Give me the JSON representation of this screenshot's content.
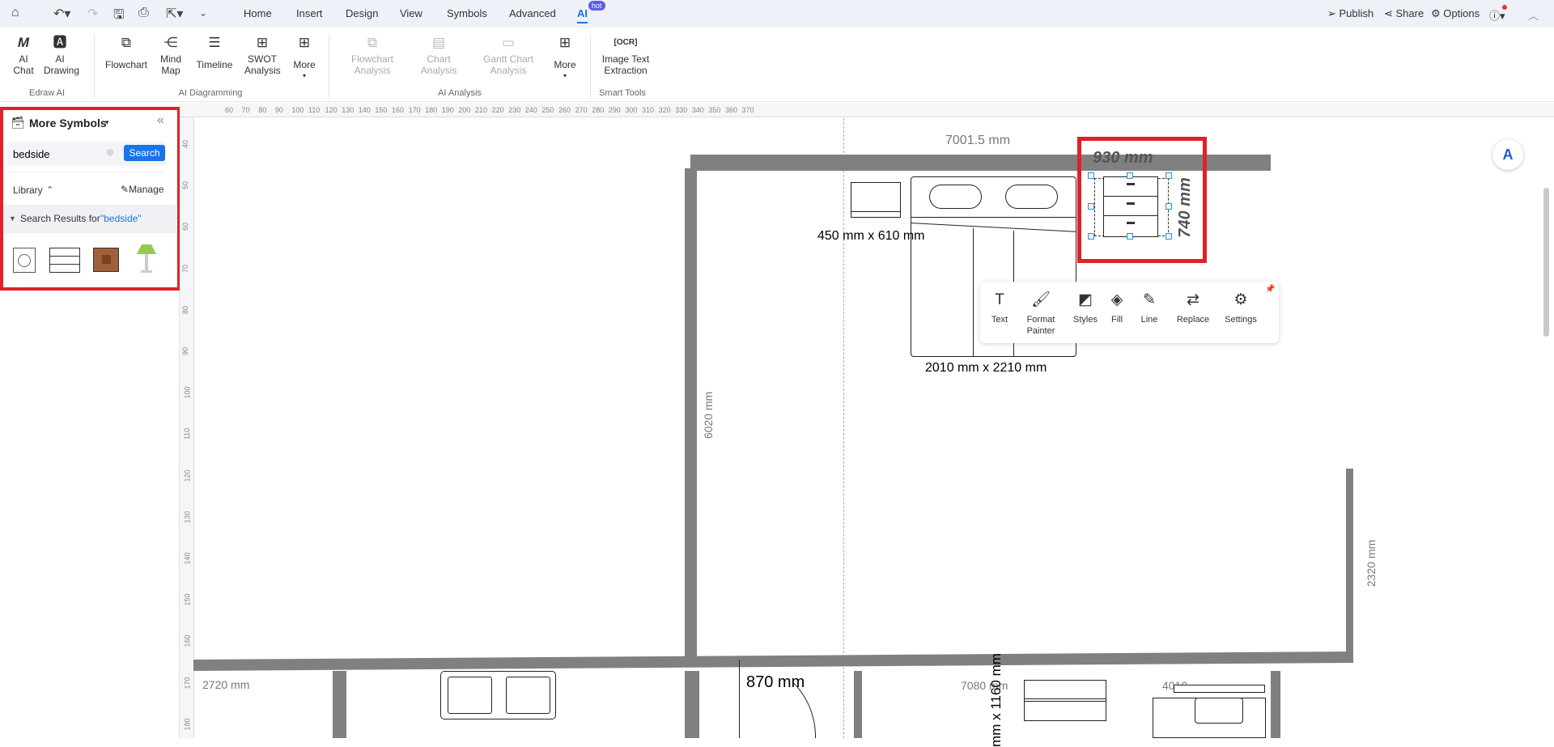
{
  "menu": {
    "tabs": [
      "Home",
      "Insert",
      "Design",
      "View",
      "Symbols",
      "Advanced",
      "AI"
    ],
    "active_tab": "AI",
    "hot_badge": "hot",
    "right": {
      "publish": "Publish",
      "share": "Share",
      "options": "Options"
    }
  },
  "ribbon": {
    "groups": [
      {
        "label": "Edraw AI",
        "items": [
          "AI Chat",
          "AI Drawing"
        ]
      },
      {
        "label": "AI Diagramming",
        "items": [
          "Flowchart",
          "Mind Map",
          "Timeline",
          "SWOT Analysis",
          "More"
        ]
      },
      {
        "label": "AI Analysis",
        "items": [
          "Flowchart Analysis",
          "Chart Analysis",
          "Gantt Chart Analysis",
          "More"
        ]
      },
      {
        "label": "Smart Tools",
        "items": [
          "Image Text Extraction"
        ]
      }
    ]
  },
  "sidebar": {
    "title": "More Symbols",
    "search_value": "bedside",
    "search_button": "Search",
    "library_label": "Library",
    "manage_label": "Manage",
    "results_prefix": "Search Results for",
    "results_query": "\"bedside\"",
    "results": [
      "safe-symbol",
      "bedside-drawer",
      "bedside-table-brown",
      "bedside-lamp"
    ]
  },
  "ruler": {
    "top": [
      "60",
      "70",
      "80",
      "90",
      "100",
      "110",
      "120",
      "130",
      "140",
      "150",
      "160",
      "170",
      "180",
      "190",
      "200",
      "210",
      "220",
      "230",
      "240",
      "250",
      "260",
      "270",
      "280",
      "290",
      "300",
      "310",
      "320",
      "330",
      "340",
      "350",
      "360",
      "370"
    ],
    "left": [
      "40",
      "50",
      "60",
      "70",
      "80",
      "90",
      "100",
      "110",
      "120",
      "130",
      "140",
      "150",
      "160",
      "170",
      "180"
    ]
  },
  "canvas": {
    "wall_top_dim": "7001.5 mm",
    "wall_left_dim": "6020 mm",
    "wall_right_dim": "2320 mm",
    "nightstand_dim": "450 mm x 610 mm",
    "bed_dim": "2010 mm x 2210 mm",
    "selected_width": "930 mm",
    "selected_height": "740 mm",
    "bottom_left_dim": "2720 mm",
    "door_dim": "870 mm",
    "bottom_mid_dim": "7080 mm",
    "bottom_vertical_dim": "mm x 1160 mm",
    "bottom_right_dim": "4010"
  },
  "floating_toolbar": [
    "Text",
    "Format Painter",
    "Styles",
    "Fill",
    "Line",
    "Replace",
    "Settings"
  ],
  "colors": {
    "accent": "#1a73e8",
    "highlight": "#e0202a",
    "wall": "#808080"
  }
}
